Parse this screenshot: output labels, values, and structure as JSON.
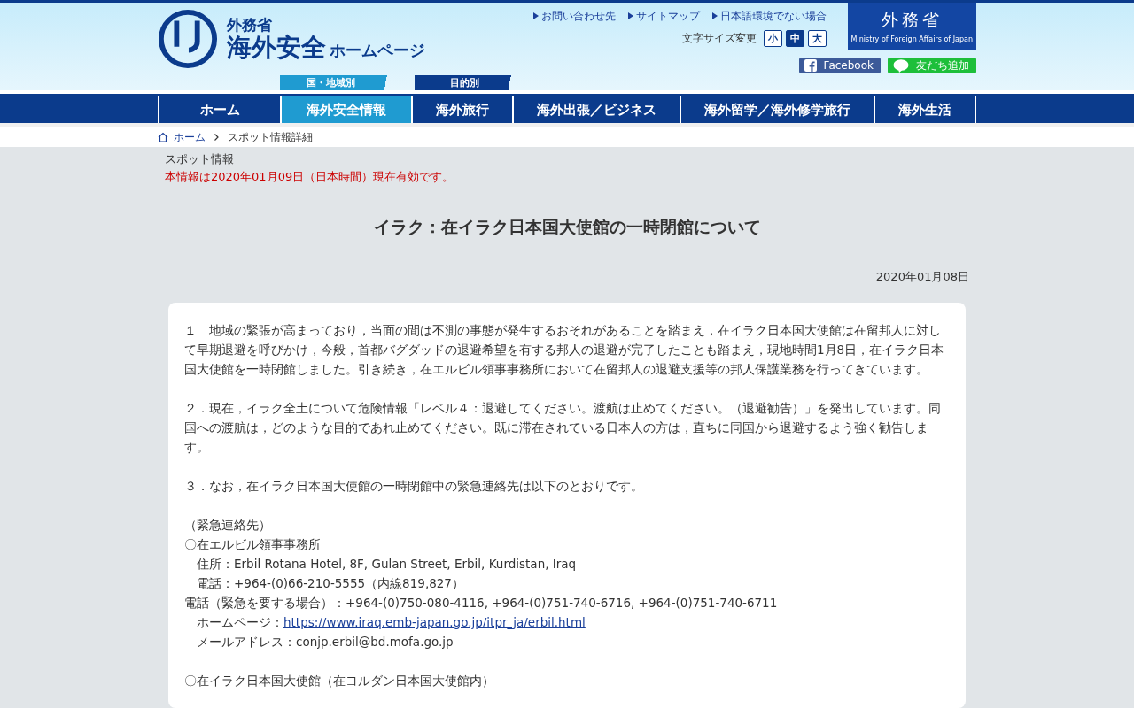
{
  "logo": {
    "ministry": "外務省",
    "title": "海外安全",
    "subtitle": "ホームページ"
  },
  "utility_links": [
    "お問い合わせ先",
    "サイトマップ",
    "日本語環境でない場合"
  ],
  "font_size": {
    "label": "文字サイズ変更",
    "options": [
      {
        "label": "小",
        "selected": false
      },
      {
        "label": "中",
        "selected": true
      },
      {
        "label": "大",
        "selected": false
      }
    ]
  },
  "mofa_badge": {
    "title": "外務省",
    "subtitle": "Ministry of Foreign Affairs of Japan"
  },
  "social": [
    {
      "kind": "facebook",
      "label": "Facebook"
    },
    {
      "kind": "line",
      "label": "友だち追加"
    }
  ],
  "nav_groups": [
    "国・地域別",
    "目的別"
  ],
  "nav": [
    {
      "label": "ホーム",
      "selected": false
    },
    {
      "label": "海外安全情報",
      "selected": true
    },
    {
      "label": "海外旅行",
      "selected": false
    },
    {
      "label": "海外出張／ビジネス",
      "selected": false
    },
    {
      "label": "海外留学／海外修学旅行",
      "selected": false
    },
    {
      "label": "海外生活",
      "selected": false
    }
  ],
  "breadcrumb": [
    "ホーム",
    "スポット情報詳細"
  ],
  "category": "スポット情報",
  "validity": "本情報は2020年01月09日（日本時間）現在有効です。",
  "title": "イラク：在イラク日本国大使館の一時閉館について",
  "date": "2020年01月08日",
  "paragraphs": [
    "１　地域の緊張が高まっており，当面の間は不測の事態が発生するおそれがあることを踏まえ，在イラク日本国大使館は在留邦人に対して早期退避を呼びかけ，今般，首都バグダッドの退避希望を有する邦人の退避が完了したことも踏まえ，現地時間1月8日，在イラク日本国大使館を一時閉館しました。引き続き，在エルビル領事事務所において在留邦人の退避支援等の邦人保護業務を行ってきています。",
    "２．現在，イラク全土について危険情報「レベル４：退避してください。渡航は止めてください。（退避勧告）」を発出しています。同国への渡航は，どのような目的であれ止めてください。既に滞在されている日本人の方は，直ちに同国から退避するよう強く勧告します。",
    "３．なお，在イラク日本国大使館の一時閉館中の緊急連絡先は以下のとおりです。"
  ],
  "contacts_heading": "（緊急連絡先）",
  "contact_blocks": [
    {
      "lines": [
        {
          "kind": "item",
          "text": "〇在エルビル領事事務所"
        },
        {
          "kind": "sub",
          "text": "住所：Erbil Rotana Hotel, 8F, Gulan Street, Erbil, Kurdistan, Iraq"
        },
        {
          "kind": "sub",
          "text": "電話：+964-(0)66-210-5555（内線819,827）"
        },
        {
          "kind": "item",
          "text": "電話（緊急を要する場合）：+964-(0)750-080-4116, +964-(0)751-740-6716, +964-(0)751-740-6711"
        },
        {
          "kind": "sub",
          "text": "ホームページ：",
          "link": "https://www.iraq.emb-japan.go.jp/itpr_ja/erbil.html"
        },
        {
          "kind": "sub",
          "text": "メールアドレス：conjp.erbil@bd.mofa.go.jp"
        }
      ]
    },
    {
      "lines": [
        {
          "kind": "item",
          "text": "〇在イラク日本国大使館（在ヨルダン日本国大使館内）"
        }
      ]
    }
  ]
}
